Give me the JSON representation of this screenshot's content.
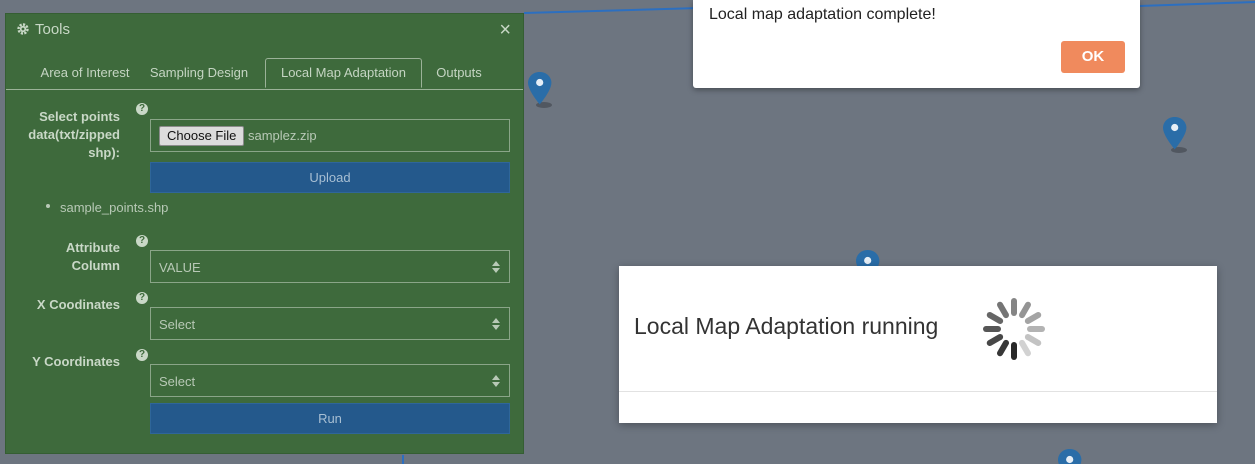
{
  "tools": {
    "title": "Tools",
    "close_glyph": "×",
    "tabs": [
      {
        "label": "Area of Interest"
      },
      {
        "label": "Sampling Design"
      },
      {
        "label": "Local Map Adaptation"
      },
      {
        "label": "Outputs"
      }
    ],
    "active_tab": "Local Map Adaptation",
    "select_points": {
      "label": "Select points data(txt/zipped shp):",
      "button": "Choose File",
      "file_name": "samplez.zip"
    },
    "upload_label": "Upload",
    "uploaded_files": [
      "sample_points.shp"
    ],
    "attribute_column": {
      "label": "Attribute Column",
      "value": "VALUE"
    },
    "x_coordinates": {
      "label": "X Coodinates",
      "value": "Select"
    },
    "y_coordinates": {
      "label": "Y Coordinates",
      "value": "Select"
    },
    "run_label": "Run",
    "help_glyph": "?"
  },
  "alert": {
    "message": "Local map adaptation complete!",
    "ok_label": "OK"
  },
  "modal": {
    "message": "Local Map Adaptation running"
  },
  "colors": {
    "panel": "#3e6a3c",
    "button_blue": "#24598c",
    "ok_orange": "#f08a5d",
    "map": "#6d7580",
    "pin": "#2a6da8"
  },
  "icons": [
    "gear-icon",
    "close-icon",
    "help-icon",
    "map-pin-icon",
    "spinner-icon",
    "select-arrows-icon"
  ]
}
